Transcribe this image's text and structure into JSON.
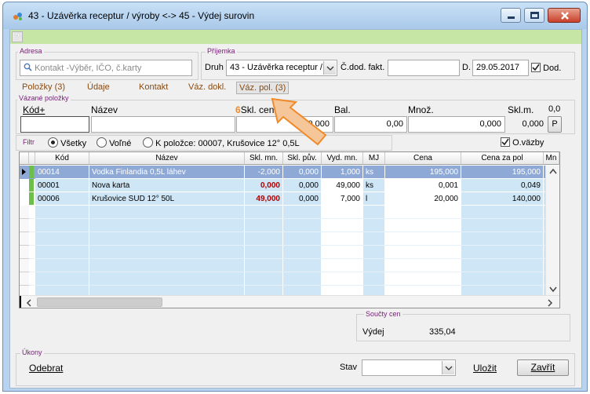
{
  "window": {
    "title": "43 - Uzávěrka receptur / výroby <-> 45 - Výdej surovin",
    "help_label": "?"
  },
  "adresa": {
    "group_label": "Adresa",
    "placeholder": "Kontakt -Výběr, IČO, č.karty"
  },
  "prijemka": {
    "group_label": "Příjemka",
    "druh_label": "Druh",
    "druh_value": "43 - Uzávěrka receptur /",
    "cdod_label": "Č.dod. fakt.",
    "cdod_value": "",
    "date_label": "D.",
    "date_value": "29.05.2017",
    "dod_label": "Dod.",
    "dod_checked": true
  },
  "tabs": [
    {
      "label": "Položky (3)"
    },
    {
      "label": "Údaje"
    },
    {
      "label": "Kontakt"
    },
    {
      "label": "Váz. dokl."
    },
    {
      "label": "Váz. pol. (3)"
    }
  ],
  "annotation": {
    "number": "6",
    "color": "#f08a2a"
  },
  "vazane": {
    "group_label": "Vázané položky",
    "kod_label": "Kód+",
    "nazev_label": "Název",
    "skl_cena_label": "Skl. cena",
    "bal_label": "Bal.",
    "mnoz_label": "Množ.",
    "sklm_label": "Skl.m.",
    "extra_value": "0,0",
    "kod_value": "",
    "nazev_value": "",
    "skl_cena_value": "0,000",
    "bal_value": "0,00",
    "mnoz_value": "0,000",
    "sklm_value": "0,000",
    "p_button": "P"
  },
  "filter": {
    "label": "Filtr",
    "options": [
      "Všetky",
      "Voľné",
      "K položce: 00007, Krušovice 12° 0,5L"
    ],
    "selected": 0,
    "ovazby_label": "O.väzby",
    "ovazby_checked": true
  },
  "grid": {
    "columns": [
      "Kód",
      "Název",
      "Skl. mn.",
      "Skl. pův.",
      "Vyd. mn.",
      "MJ",
      "Cena",
      "Cena za pol",
      "Mn"
    ],
    "rows": [
      [
        "00014",
        "Vodka Finlandia 0,5L láhev",
        "-2,000",
        "0,000",
        "1,000",
        "ks",
        "195,000",
        "195,000",
        "40"
      ],
      [
        "00001",
        "Nova karta",
        "0,000",
        "0,000",
        "49,000",
        "ks",
        "0,001",
        "0,049",
        "00"
      ],
      [
        "00006",
        "Krušovice SUD 12° 50L",
        "49,000",
        "0,000",
        "7,000",
        "l",
        "20,000",
        "140,000",
        "00"
      ]
    ],
    "selected_row": 0,
    "negative_color": "#b00000",
    "selected_color": "#8fa9d6",
    "column_tint": "#cfe6f6"
  },
  "souctY": {
    "group_label": "Součty cen",
    "vydej_label": "Výdej",
    "vydej_value": "335,04"
  },
  "ukony": {
    "group_label": "Úkony",
    "odebrat_label": "Odebrat",
    "stav_label": "Stav",
    "stav_value": "",
    "ulozit_label": "Uložit",
    "zavrit_label": "Zavřít"
  }
}
